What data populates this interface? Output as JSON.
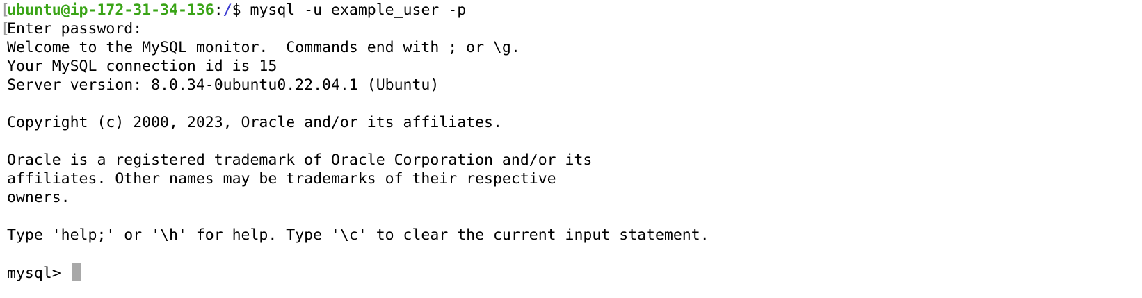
{
  "terminal": {
    "prompt": {
      "user_host": "ubuntu@ip-172-31-34-136",
      "separator": ":",
      "path": "/",
      "symbol": "$ ",
      "command": "mysql -u example_user -p"
    },
    "bracket_glyph": "[",
    "lines": [
      "Enter password:",
      "Welcome to the MySQL monitor.  Commands end with ; or \\g.",
      "Your MySQL connection id is 15",
      "Server version: 8.0.34-0ubuntu0.22.04.1 (Ubuntu)",
      "",
      "Copyright (c) 2000, 2023, Oracle and/or its affiliates.",
      "",
      "Oracle is a registered trademark of Oracle Corporation and/or its",
      "affiliates. Other names may be trademarks of their respective",
      "owners.",
      "",
      "Type 'help;' or '\\h' for help. Type '\\c' to clear the current input statement.",
      ""
    ],
    "mysql_prompt": "mysql> ",
    "colors": {
      "user_host": "#3aa417",
      "path": "#3b3bd1",
      "text": "#000000",
      "cursor": "#a8a8a8",
      "background": "#ffffff"
    }
  }
}
